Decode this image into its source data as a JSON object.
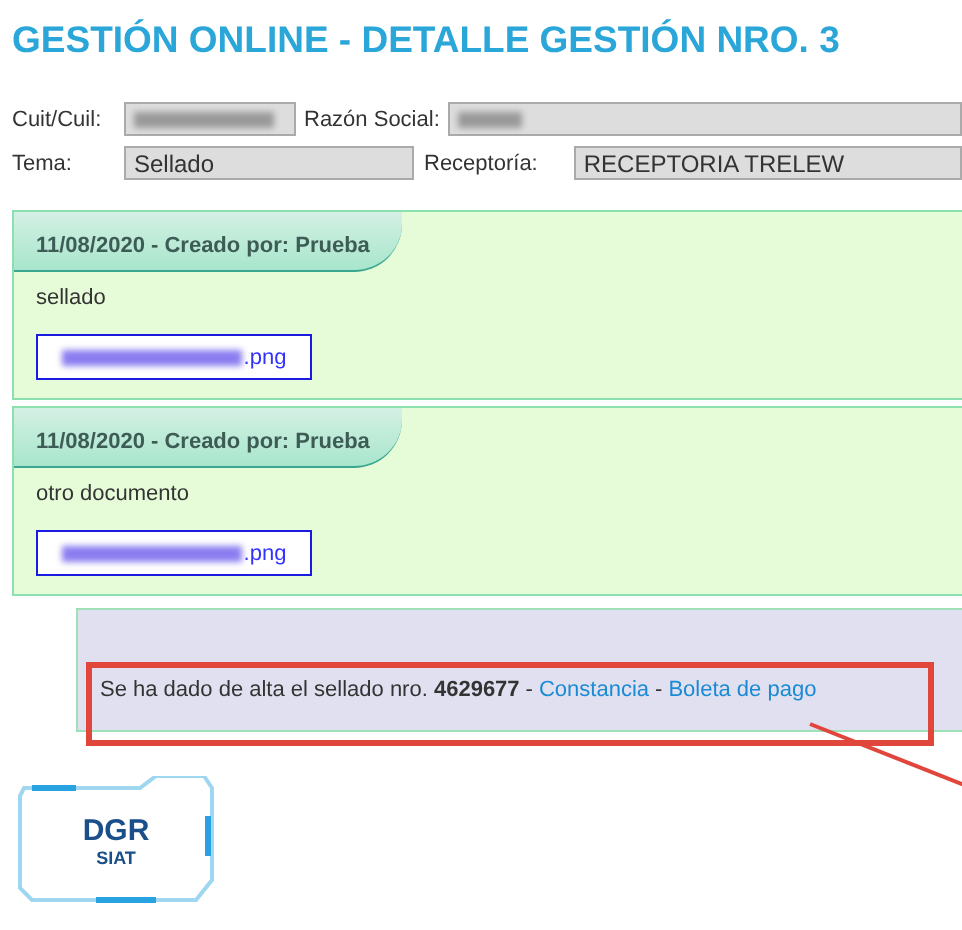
{
  "title": "GESTIÓN ONLINE - DETALLE GESTIÓN NRO. 3",
  "form": [
    {
      "label": "Cuit/Cuil:",
      "value_redacted": true,
      "label2": "Razón Social:",
      "value2_redacted": true
    },
    {
      "label": "Tema:",
      "value_redacted": false,
      "value": "Sellado",
      "label2": "Receptoría:",
      "value2_redacted": false,
      "value2": "RECEPTORIA TRELEW"
    }
  ],
  "entries": [
    {
      "header": "11/08/2020 - Creado por: Prueba",
      "text": "sellado",
      "attachment": ".png"
    },
    {
      "header": "11/08/2020 - Creado por: Prueba",
      "text": "otro documento",
      "attachment": ".png"
    }
  ],
  "notice": {
    "text": "Se ha dado de alta el sellado nro. **4629677**",
    "separator": "-",
    "links": [
      "Constancia",
      "Boleta de pago"
    ]
  },
  "logo": {
    "title": "DGR",
    "subtitle": "SIAT"
  }
}
